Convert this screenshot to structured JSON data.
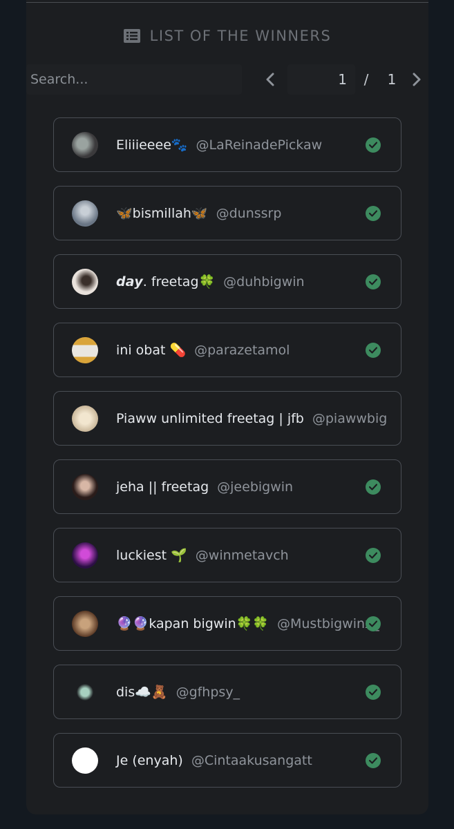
{
  "header": {
    "title": "LIST OF THE WINNERS",
    "icon": "list-icon"
  },
  "search": {
    "placeholder": "Search..."
  },
  "pager": {
    "current": "1",
    "separator": "/",
    "total": "1"
  },
  "colors": {
    "verified": "#3d8b5f",
    "card_border": "#4a4e55"
  },
  "winners": [
    {
      "name": "Eliiieeee🐾",
      "handle": "@LaReinadePickaw",
      "verified": true
    },
    {
      "name": "🦋bismillah🦋",
      "handle": "@dunssrp",
      "verified": true
    },
    {
      "name": "𝙙𝙖𝙮. freetag🍀",
      "handle": "@duhbigwin",
      "verified": true
    },
    {
      "name": "ini obat 💊",
      "handle": "@parazetamol",
      "verified": true
    },
    {
      "name": "Piaww unlimited freetag | jfb",
      "handle": "@piawwbig",
      "verified": false
    },
    {
      "name": "jeha || freetag",
      "handle": "@jeebigwin",
      "verified": true
    },
    {
      "name": "luckiest 🌱",
      "handle": "@winmetavch",
      "verified": true
    },
    {
      "name": "🔮🔮kapan bigwin🍀🍀",
      "handle": "@Mustbigwinx_",
      "verified": true
    },
    {
      "name": "dis☁️🧸",
      "handle": "@gfhpsy_",
      "verified": true
    },
    {
      "name": "Je (enyah)",
      "handle": "@Cintaakusangatt",
      "verified": true
    }
  ]
}
